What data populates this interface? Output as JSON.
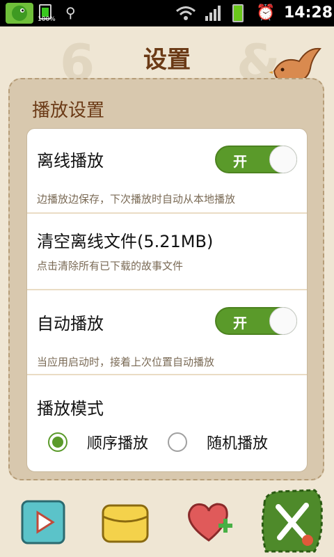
{
  "status_bar": {
    "battery_percent": "100%",
    "time": "14:28",
    "icons": [
      "app-icon",
      "battery-icon",
      "usb-icon",
      "wifi-icon",
      "signal-icon",
      "battery-icon",
      "alarm-icon"
    ]
  },
  "header": {
    "title": "设置"
  },
  "playback_section": {
    "title": "播放设置",
    "offline_play": {
      "title": "离线播放",
      "description": "边播放边保存，下次播放时自动从本地播放",
      "toggle_label": "开"
    },
    "clear_offline": {
      "title": "清空离线文件(5.21MB)",
      "description": "点击清除所有已下载的故事文件"
    },
    "auto_play": {
      "title": "自动播放",
      "description": "当应用启动时，接着上次位置自动播放",
      "toggle_label": "开"
    },
    "play_mode": {
      "title": "播放模式",
      "options": [
        "顺序播放",
        "随机播放"
      ],
      "selected": "顺序播放"
    }
  },
  "bottom_nav": {
    "items": [
      "play-icon",
      "folder-icon",
      "favorite-add-icon",
      "settings-tools-icon"
    ],
    "active": "settings-tools-icon"
  },
  "colors": {
    "background": "#efe6d4",
    "accent_green": "#5a9a2a",
    "title_brown": "#6b3a16"
  }
}
